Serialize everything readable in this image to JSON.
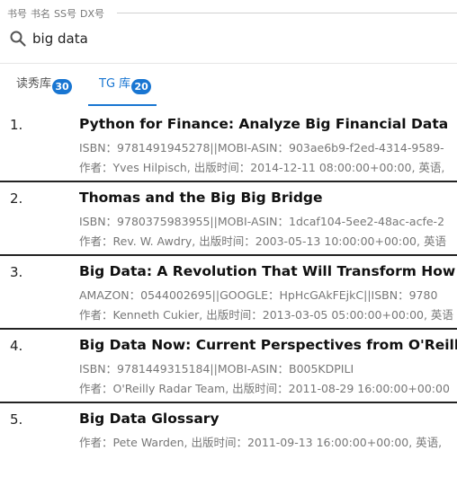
{
  "search": {
    "legend_items": [
      "书号",
      "书名",
      "SS号",
      "DX号"
    ],
    "query": "big data"
  },
  "tabs": [
    {
      "label": "读秀库",
      "count": "30",
      "active": false
    },
    {
      "label": "TG 库",
      "count": "20",
      "active": true
    }
  ],
  "results": [
    {
      "index": "1.",
      "title": "Python for Finance: Analyze Big Financial Data",
      "meta1": "ISBN：9781491945278||MOBI-ASIN：903ae6b9-f2ed-4314-9589-",
      "meta2": "作者：Yves Hilpisch, 出版时间：2014-12-11 08:00:00+00:00, 英语,"
    },
    {
      "index": "2.",
      "title": "Thomas and the Big Big Bridge",
      "meta1": "ISBN：9780375983955||MOBI-ASIN：1dcaf104-5ee2-48ac-acfe-2",
      "meta2": "作者：Rev. W. Awdry, 出版时间：2003-05-13 10:00:00+00:00, 英语"
    },
    {
      "index": "3.",
      "title": "Big Data: A Revolution That Will Transform How We Live",
      "meta1": "AMAZON：0544002695||GOOGLE：HpHcGAkFEjkC||ISBN：9780",
      "meta2": "作者：Kenneth Cukier, 出版时间：2013-03-05 05:00:00+00:00, 英语"
    },
    {
      "index": "4.",
      "title": "Big Data Now: Current Perspectives from O'Reilly Radar",
      "meta1": "ISBN：9781449315184||MOBI-ASIN：B005KDPILI",
      "meta2": "作者：O'Reilly Radar Team, 出版时间：2011-08-29 16:00:00+00:00"
    },
    {
      "index": "5.",
      "title": "Big Data Glossary",
      "meta1": "作者：Pete Warden, 出版时间：2011-09-13 16:00:00+00:00, 英语,",
      "meta2": ""
    }
  ]
}
